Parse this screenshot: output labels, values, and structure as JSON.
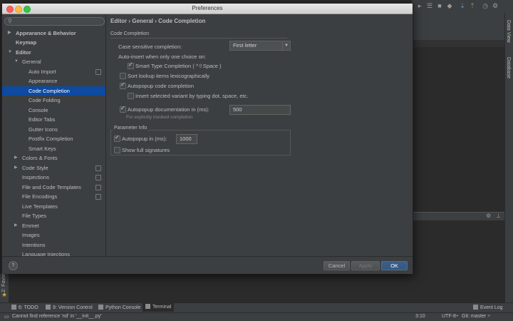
{
  "dialog": {
    "title": "Preferences",
    "colors": {
      "selection": "#0d4aa0",
      "background": "#3c3f41",
      "close": "#fc605c",
      "minimize": "#fdbc40",
      "maximize": "#34c84a"
    }
  },
  "search": {
    "placeholder": ""
  },
  "tree": [
    {
      "label": "Appearance & Behavior"
    },
    {
      "label": "Keymap"
    },
    {
      "label": "Editor"
    },
    {
      "label": "General"
    },
    {
      "label": "Auto Import"
    },
    {
      "label": "Appearance"
    },
    {
      "label": "Code Completion"
    },
    {
      "label": "Code Folding"
    },
    {
      "label": "Console"
    },
    {
      "label": "Editor Tabs"
    },
    {
      "label": "Gutter Icons"
    },
    {
      "label": "Postfix Completion"
    },
    {
      "label": "Smart Keys"
    },
    {
      "label": "Colors & Fonts"
    },
    {
      "label": "Code Style"
    },
    {
      "label": "Inspections"
    },
    {
      "label": "File and Code Templates"
    },
    {
      "label": "File Encodings"
    },
    {
      "label": "Live Templates"
    },
    {
      "label": "File Types"
    },
    {
      "label": "Emmet"
    },
    {
      "label": "Images"
    },
    {
      "label": "Intentions"
    },
    {
      "label": "Language Injections"
    }
  ],
  "breadcrumb": "Editor › General › Code Completion",
  "code_completion": {
    "section_title": "Code Completion",
    "case_sensitive_label": "Case sensitive completion:",
    "case_sensitive_value": "First letter",
    "auto_insert_label": "Auto-insert when only one choice on:",
    "smart_type_label": "Smart Type Completion ( ^⇧Space )",
    "smart_type_checked": true,
    "sort_lexico_label": "Sort lookup items lexicographically",
    "sort_lexico_checked": false,
    "autopopup_label": "Autopopup code completion",
    "autopopup_checked": true,
    "insert_selected_label": "Insert selected variant by typing dot, space, etc.",
    "insert_selected_checked": false,
    "autopopup_doc_label": "Autopopup documentation in (ms):",
    "autopopup_doc_checked": true,
    "autopopup_doc_value": "500",
    "explicit_note": "For explicitly invoked completion"
  },
  "parameter_info": {
    "section_title": "Parameter Info",
    "autopopup_label": "Autopopup in (ms):",
    "autopopup_checked": true,
    "autopopup_value": "1000",
    "full_signatures_label": "Show full signatures",
    "full_signatures_checked": false
  },
  "footer": {
    "help_label": "?",
    "cancel_label": "Cancel",
    "apply_label": "Apply",
    "ok_label": "OK"
  },
  "ide": {
    "right_tabs": [
      "Data View",
      "Database"
    ],
    "left_tab": "2: Favor",
    "toolwindows": [
      "6: TODO",
      "9: Version Control",
      "Python Console",
      "Terminal"
    ],
    "event_log": "Event Log",
    "status_message": "Cannot find reference 'nd' in '__init__.py'",
    "cursor_pos": "3:10",
    "encoding": "UTF-8÷",
    "git_branch": "Git: master ÷"
  }
}
